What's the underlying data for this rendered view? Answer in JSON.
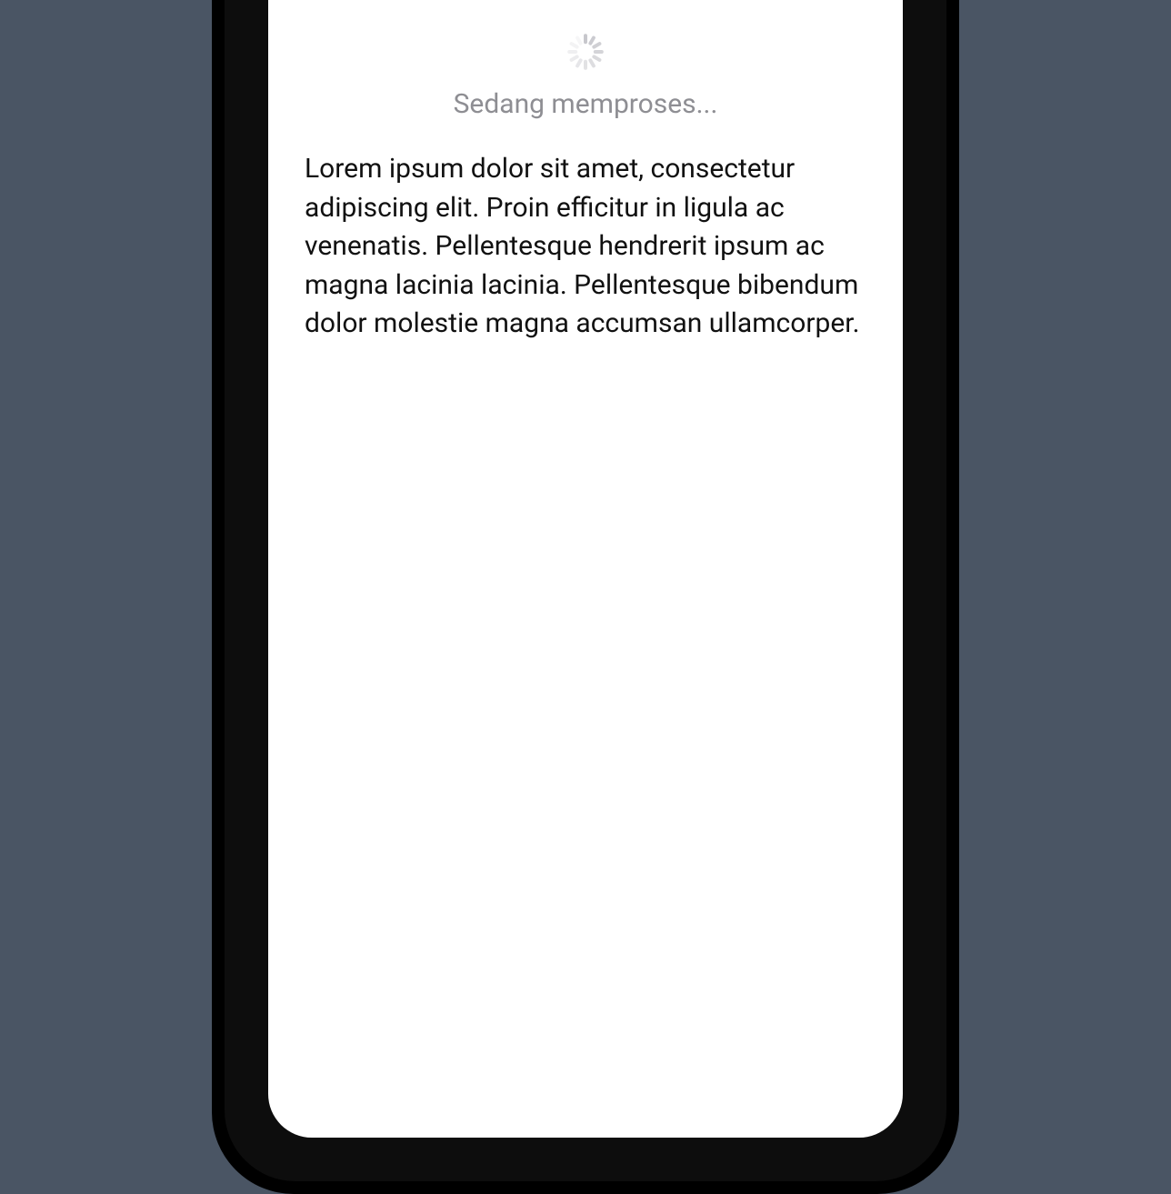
{
  "loading": {
    "text": "Sedang memproses..."
  },
  "content": {
    "paragraph": "Lorem ipsum dolor sit amet, consectetur adipiscing elit. Proin efficitur in ligula ac venenatis. Pellentesque hendrerit ipsum ac magna lacinia lacinia. Pellentesque bibendum dolor molestie magna accumsan ullamcorper."
  },
  "colors": {
    "background": "#4a5564",
    "spinner": "#c7c7cc",
    "loading_text": "#8e8e93",
    "body_text": "#111111"
  }
}
